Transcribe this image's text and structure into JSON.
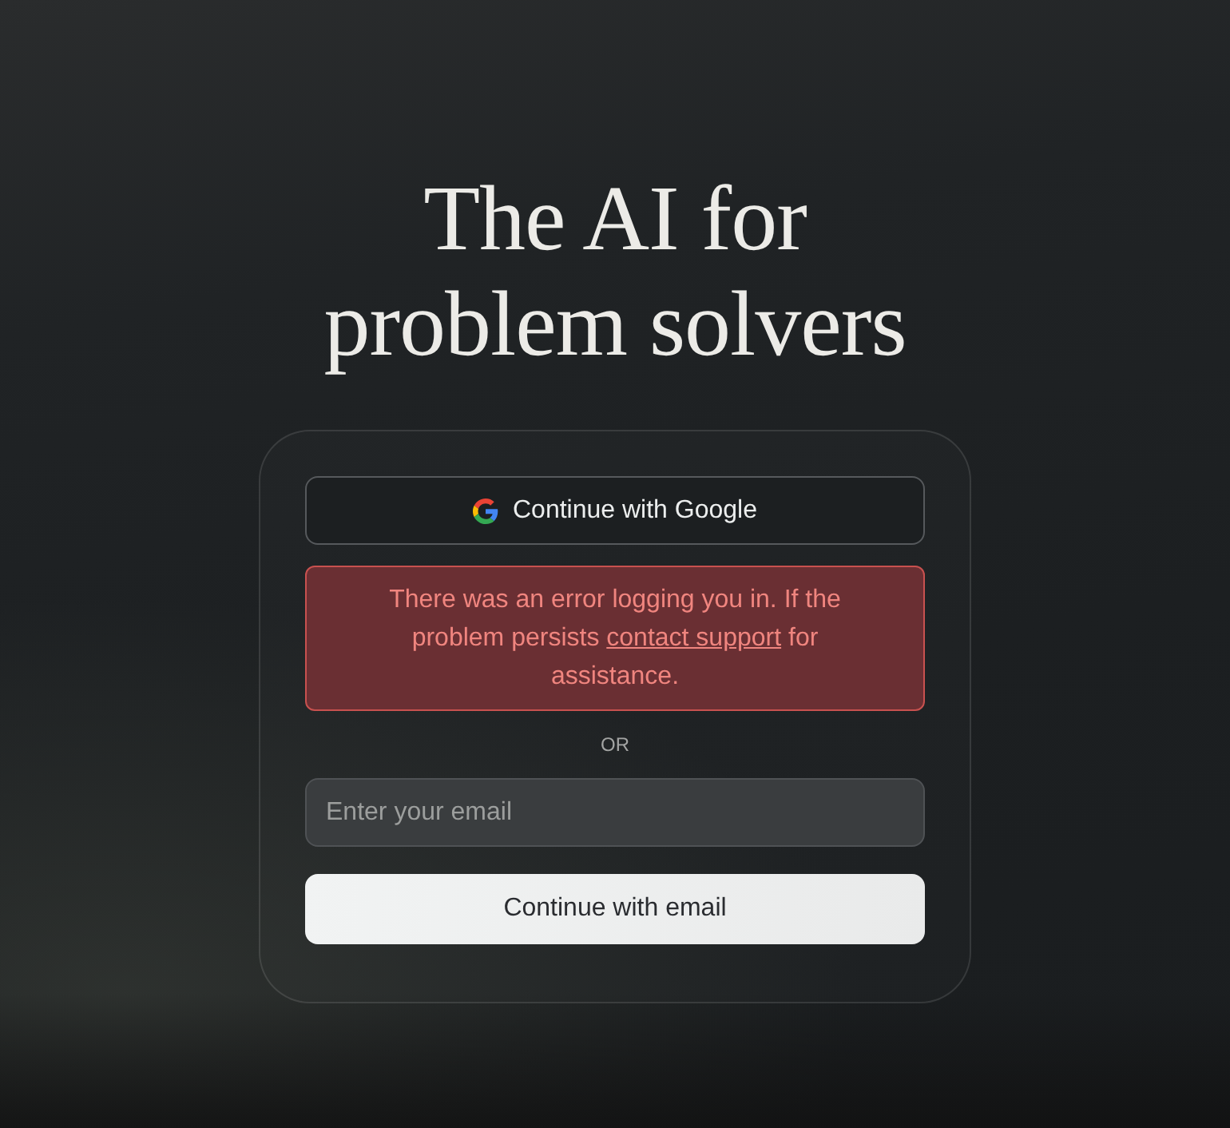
{
  "headline": "The AI for problem solvers",
  "login": {
    "google_button": "Continue with Google",
    "error": {
      "text": "There was an error logging you in. If the problem persists ",
      "link": "contact support",
      "text_after": " for assistance."
    },
    "divider": "OR",
    "email": {
      "placeholder": "Enter your email"
    },
    "submit_button": "Continue with email"
  }
}
